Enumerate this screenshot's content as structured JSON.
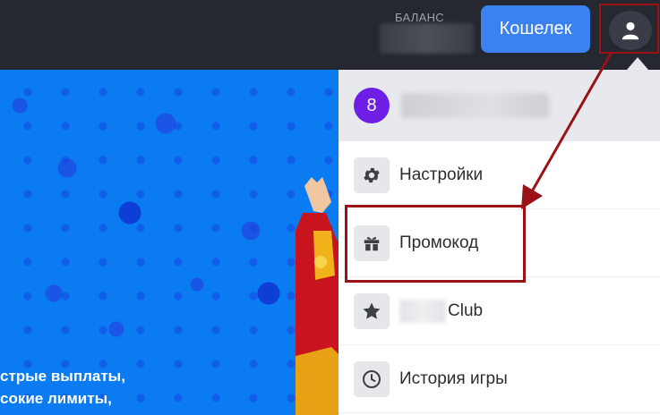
{
  "header": {
    "balance_label": "БАЛАНС",
    "wallet_button": "Кошелек",
    "profile_icon": "user-icon"
  },
  "hero": {
    "line1": "стрые выплаты,",
    "line2": "сокие лимиты,"
  },
  "menu": {
    "level": "8",
    "items": [
      {
        "label": "Настройки",
        "icon": "gear-icon"
      },
      {
        "label": "Промокод",
        "icon": "gift-icon"
      },
      {
        "label": "Club",
        "icon": "star-icon"
      },
      {
        "label": "История игры",
        "icon": "clock-icon"
      }
    ]
  },
  "colors": {
    "topbar": "#252830",
    "accent": "#3b82f0",
    "level_badge": "#6d1fe6",
    "annotation": "#9a1116",
    "hero_bg": "#0b7bf2"
  }
}
